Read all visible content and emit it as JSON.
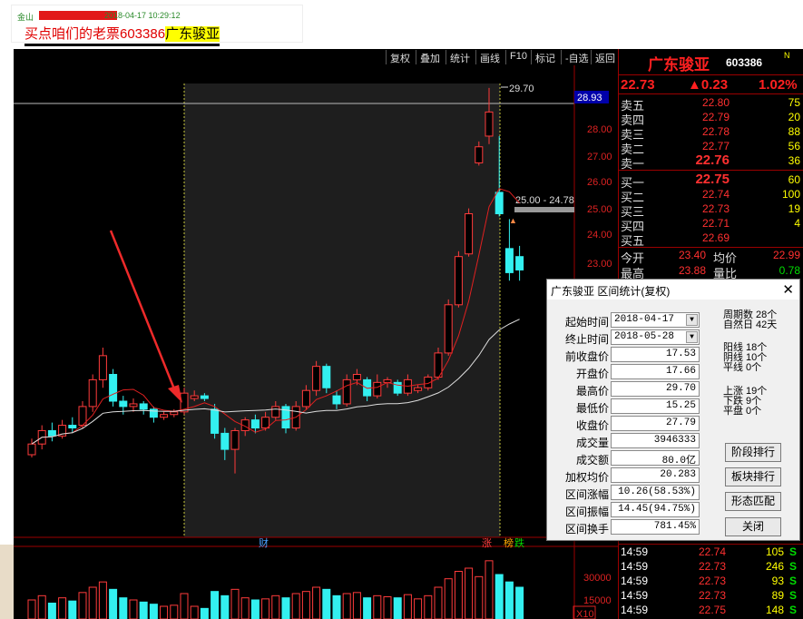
{
  "post": {
    "user": "金山",
    "timestamp": "2018-04-17 10:29:12",
    "title_prefix": "买点咱们的老票603386",
    "title_highlight": "广东骏亚"
  },
  "toolbar": [
    "复权",
    "叠加",
    "统计",
    "画线",
    "F10",
    "标记",
    "-自选",
    "返回"
  ],
  "chart": {
    "price_ticks": [
      "28.00",
      "27.00",
      "26.00",
      "25.00",
      "24.00",
      "23.00"
    ],
    "current_price_tag": "28.93",
    "high_marker": "29.70",
    "range_label": "25.00 - 24.78",
    "marker_cai": "财",
    "marker_zhang": "涨",
    "marker_bang": "榜",
    "marker_die": "跌",
    "volume_ticks": [
      "30000",
      "15000"
    ],
    "volume_unit": "X10",
    "candles": [
      {
        "o": 16.0,
        "c": 16.4,
        "h": 16.6,
        "l": 15.9
      },
      {
        "o": 16.4,
        "c": 16.9,
        "h": 17.1,
        "l": 16.2
      },
      {
        "o": 16.9,
        "c": 16.7,
        "h": 17.2,
        "l": 16.5
      },
      {
        "o": 16.7,
        "c": 17.1,
        "h": 17.3,
        "l": 16.6
      },
      {
        "o": 17.1,
        "c": 17.0,
        "h": 17.4,
        "l": 16.8
      },
      {
        "o": 17.1,
        "c": 17.8,
        "h": 18.0,
        "l": 17.0
      },
      {
        "o": 17.8,
        "c": 18.8,
        "h": 19.0,
        "l": 17.6
      },
      {
        "o": 18.8,
        "c": 19.7,
        "h": 20.0,
        "l": 18.5
      },
      {
        "o": 19.0,
        "c": 18.0,
        "h": 19.2,
        "l": 17.8
      },
      {
        "o": 18.0,
        "c": 17.8,
        "h": 18.2,
        "l": 17.5
      },
      {
        "o": 17.8,
        "c": 17.9,
        "h": 18.1,
        "l": 17.6
      },
      {
        "o": 17.9,
        "c": 17.7,
        "h": 18.0,
        "l": 17.5
      },
      {
        "o": 17.7,
        "c": 17.4,
        "h": 17.8,
        "l": 17.2
      },
      {
        "o": 17.4,
        "c": 17.5,
        "h": 17.6,
        "l": 17.3
      },
      {
        "o": 17.5,
        "c": 17.6,
        "h": 17.7,
        "l": 17.4
      },
      {
        "o": 17.6,
        "c": 18.3,
        "h": 18.5,
        "l": 17.5
      },
      {
        "o": 18.1,
        "c": 18.2,
        "h": 18.4,
        "l": 18.0
      },
      {
        "o": 18.2,
        "c": 18.1,
        "h": 18.3,
        "l": 18.0
      },
      {
        "o": 17.7,
        "c": 16.8,
        "h": 17.9,
        "l": 16.6
      },
      {
        "o": 16.8,
        "c": 16.2,
        "h": 17.0,
        "l": 15.8
      },
      {
        "o": 16.2,
        "c": 16.9,
        "h": 17.0,
        "l": 15.3
      },
      {
        "o": 16.9,
        "c": 17.3,
        "h": 17.4,
        "l": 16.7
      },
      {
        "o": 17.3,
        "c": 17.0,
        "h": 17.5,
        "l": 16.8
      },
      {
        "o": 17.0,
        "c": 17.4,
        "h": 17.6,
        "l": 16.9
      },
      {
        "o": 17.4,
        "c": 17.8,
        "h": 18.0,
        "l": 17.3
      },
      {
        "o": 17.8,
        "c": 17.0,
        "h": 17.9,
        "l": 16.8
      },
      {
        "o": 17.0,
        "c": 17.8,
        "h": 18.0,
        "l": 16.9
      },
      {
        "o": 17.8,
        "c": 18.4,
        "h": 18.6,
        "l": 17.7
      },
      {
        "o": 18.4,
        "c": 19.3,
        "h": 19.5,
        "l": 18.2
      },
      {
        "o": 19.3,
        "c": 18.5,
        "h": 19.4,
        "l": 18.3
      },
      {
        "o": 18.2,
        "c": 17.9,
        "h": 18.4,
        "l": 17.7
      },
      {
        "o": 17.9,
        "c": 18.8,
        "h": 19.0,
        "l": 17.8
      },
      {
        "o": 18.8,
        "c": 19.0,
        "h": 19.2,
        "l": 18.6
      },
      {
        "o": 18.8,
        "c": 18.2,
        "h": 18.9,
        "l": 18.0
      },
      {
        "o": 18.2,
        "c": 18.7,
        "h": 19.0,
        "l": 18.1
      },
      {
        "o": 18.7,
        "c": 18.8,
        "h": 18.9,
        "l": 18.5
      },
      {
        "o": 18.7,
        "c": 18.3,
        "h": 18.8,
        "l": 18.2
      },
      {
        "o": 18.3,
        "c": 18.8,
        "h": 19.0,
        "l": 18.2
      },
      {
        "o": 18.4,
        "c": 18.5,
        "h": 18.6,
        "l": 18.3
      },
      {
        "o": 18.5,
        "c": 18.9,
        "h": 19.0,
        "l": 18.4
      },
      {
        "o": 18.9,
        "c": 19.8,
        "h": 20.0,
        "l": 18.8
      },
      {
        "o": 19.8,
        "c": 21.6,
        "h": 21.8,
        "l": 19.7
      },
      {
        "o": 21.6,
        "c": 23.4,
        "h": 23.6,
        "l": 21.5
      },
      {
        "o": 23.5,
        "c": 25.0,
        "h": 25.2,
        "l": 23.4
      },
      {
        "o": 26.9,
        "c": 27.5,
        "h": 27.7,
        "l": 26.8
      },
      {
        "o": 27.9,
        "c": 28.8,
        "h": 29.7,
        "l": 27.6
      },
      {
        "o": 25.8,
        "c": 25.0,
        "h": 27.9,
        "l": 24.9
      },
      {
        "o": 23.7,
        "c": 22.8,
        "h": 24.8,
        "l": 22.5
      },
      {
        "o": 23.4,
        "c": 22.9,
        "h": 23.8,
        "l": 22.5
      }
    ],
    "volumes": [
      18,
      22,
      15,
      20,
      17,
      25,
      30,
      35,
      28,
      20,
      18,
      16,
      14,
      12,
      13,
      24,
      12,
      10,
      26,
      22,
      28,
      20,
      18,
      19,
      22,
      20,
      24,
      26,
      30,
      28,
      22,
      24,
      25,
      20,
      22,
      21,
      20,
      23,
      19,
      22,
      30,
      38,
      45,
      48,
      40,
      55,
      42,
      35,
      30
    ]
  },
  "panel": {
    "name": "广东骏亚",
    "code": "603386",
    "flag": "N",
    "price": "22.73",
    "change": "▲0.23",
    "pct": "1.02%",
    "asks": [
      {
        "label": "卖五",
        "price": "22.80",
        "vol": "75"
      },
      {
        "label": "卖四",
        "price": "22.79",
        "vol": "20"
      },
      {
        "label": "卖三",
        "price": "22.78",
        "vol": "88"
      },
      {
        "label": "卖二",
        "price": "22.77",
        "vol": "56"
      },
      {
        "label": "卖一",
        "price": "22.76",
        "vol": "36"
      }
    ],
    "bids": [
      {
        "label": "买一",
        "price": "22.75",
        "vol": "60"
      },
      {
        "label": "买二",
        "price": "22.74",
        "vol": "100"
      },
      {
        "label": "买三",
        "price": "22.73",
        "vol": "19"
      },
      {
        "label": "买四",
        "price": "22.71",
        "vol": "4"
      },
      {
        "label": "买五",
        "price": "22.69",
        "vol": ""
      }
    ],
    "stats": [
      {
        "l1": "今开",
        "v1": "23.40",
        "l2": "均价",
        "v2": "22.99",
        "c2": "#ff3030"
      },
      {
        "l1": "最高",
        "v1": "23.88",
        "l2": "量比",
        "v2": "0.78",
        "c2": "#00dd00"
      }
    ],
    "ticks": [
      {
        "time": "14:59",
        "price": "22.74",
        "vol": "105",
        "side": "S"
      },
      {
        "time": "14:59",
        "price": "22.73",
        "vol": "246",
        "side": "S"
      },
      {
        "time": "14:59",
        "price": "22.73",
        "vol": "93",
        "side": "S"
      },
      {
        "time": "14:59",
        "price": "22.73",
        "vol": "89",
        "side": "S"
      },
      {
        "time": "14:59",
        "price": "22.75",
        "vol": "148",
        "side": "S"
      }
    ]
  },
  "dialog": {
    "title": "广东骏亚 区间统计(复权)",
    "fields": [
      {
        "label": "起始时间",
        "value": "2018-04-17",
        "dropdown": true
      },
      {
        "label": "终止时间",
        "value": "2018-05-28",
        "dropdown": true
      },
      {
        "label": "前收盘价",
        "value": "17.53"
      },
      {
        "label": "开盘价",
        "value": "17.66"
      },
      {
        "label": "最高价",
        "value": "29.70"
      },
      {
        "label": "最低价",
        "value": "15.25"
      },
      {
        "label": "收盘价",
        "value": "27.79"
      },
      {
        "label": "成交量",
        "value": "3946333"
      },
      {
        "label": "成交额",
        "value": "80.0亿"
      },
      {
        "label": "加权均价",
        "value": "20.283"
      },
      {
        "label": "区间涨幅",
        "value": "10.26(58.53%)"
      },
      {
        "label": "区间振幅",
        "value": "14.45(94.75%)"
      },
      {
        "label": "区间换手",
        "value": "781.45%"
      }
    ],
    "period_stats": [
      "周期数 28个",
      "自然日 42天"
    ],
    "yin_yang": [
      "阳线 18个",
      "阴线 10个",
      "平线 0个"
    ],
    "up_down": [
      "上涨 19个",
      "下跌 9个",
      "平盘 0个"
    ],
    "buttons": [
      "阶段排行",
      "板块排行",
      "形态匹配",
      "关闭"
    ]
  }
}
